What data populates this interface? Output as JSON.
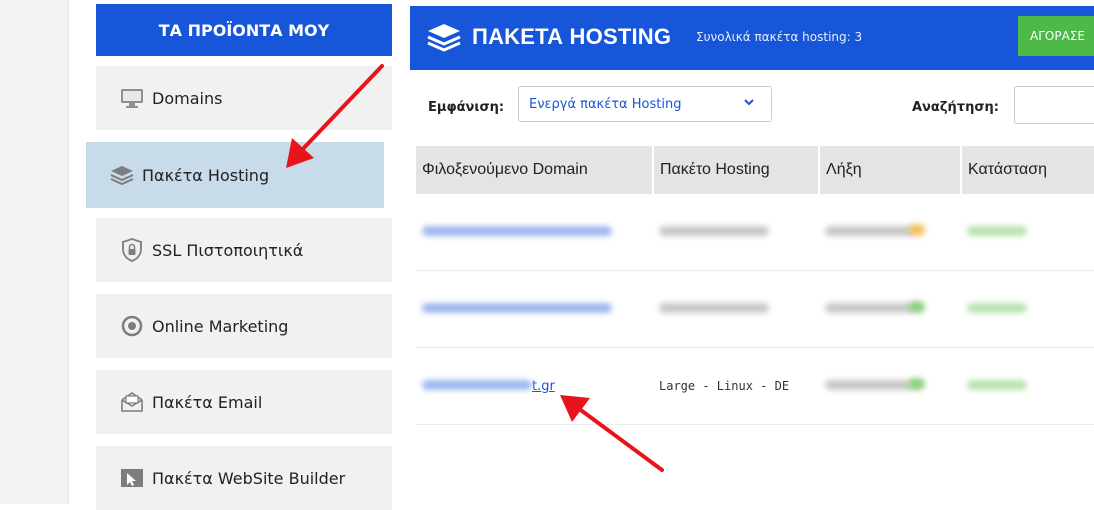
{
  "sidebar": {
    "header": "ΤΑ ΠΡΟΪΟΝΤΑ ΜΟΥ",
    "items": [
      {
        "label": "Domains",
        "icon": "monitor-icon"
      },
      {
        "label": "Πακέτα Hosting",
        "icon": "layers-icon",
        "active": true
      },
      {
        "label": "SSL Πιστοποιητικά",
        "icon": "shield-lock-icon"
      },
      {
        "label": "Online Marketing",
        "icon": "target-icon"
      },
      {
        "label": "Πακέτα Email",
        "icon": "envelope-icon"
      },
      {
        "label": "Πακέτα WebSite Builder",
        "icon": "cursor-window-icon"
      }
    ]
  },
  "main": {
    "title": "ΠΑΚΕΤΑ HOSTING",
    "subtitle": "Συνολικά πακέτα hosting: 3",
    "buy_label": "ΑΓΟΡΑΣΕ",
    "filter": {
      "show_label": "Εμφάνιση:",
      "selected": "Ενεργά πακέτα Hosting",
      "search_label": "Αναζήτηση:"
    },
    "table": {
      "headers": [
        "Φιλοξενούμενο Domain",
        "Πακέτο Hosting",
        "Λήξη",
        "Κατάσταση"
      ],
      "rows": [
        {
          "domain": "",
          "plan": "",
          "expires": "",
          "status": ""
        },
        {
          "domain": "",
          "plan": "",
          "expires": "",
          "status": ""
        },
        {
          "domain": "t.gr",
          "plan": "Large - Linux - DE",
          "expires": "",
          "status": ""
        }
      ]
    }
  },
  "colors": {
    "brand_blue": "#1756d8",
    "buy_green": "#4cb948",
    "active_item_bg": "#c8dbe9",
    "arrow_red": "#e8141c"
  }
}
